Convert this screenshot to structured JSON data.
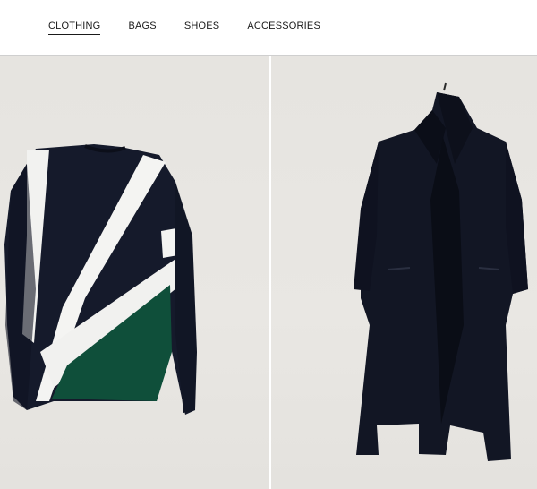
{
  "nav": {
    "items": [
      {
        "label": "CLOTHING",
        "active": true
      },
      {
        "label": "BAGS",
        "active": false
      },
      {
        "label": "SHOES",
        "active": false
      },
      {
        "label": "ACCESSORIES",
        "active": false
      }
    ]
  },
  "products": [
    {
      "kind": "sweater",
      "colors": {
        "body": "#151a2b",
        "stripe": "#f4f4f2",
        "green": "#0f4f3a"
      }
    },
    {
      "kind": "coat",
      "colors": {
        "body": "#121624"
      }
    }
  ]
}
